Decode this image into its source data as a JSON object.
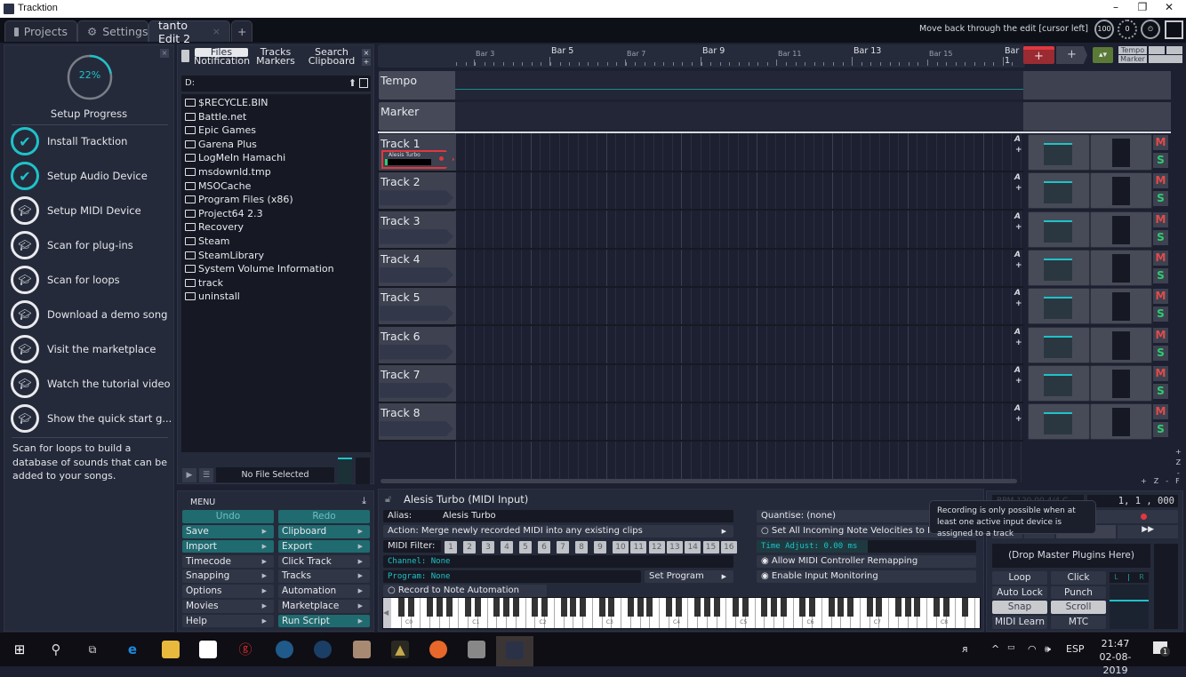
{
  "window": {
    "title": "Tracktion",
    "minimize": "–",
    "maximize": "❐",
    "close": "✕"
  },
  "tabs": [
    {
      "label": "Projects",
      "icon": "folder-icon"
    },
    {
      "label": "Settings",
      "icon": "gear-icon"
    },
    {
      "label": "tanto Edit 2",
      "active": true,
      "close": "×"
    }
  ],
  "add_tab": "+",
  "header": {
    "hint": "Move back through the edit [cursor left]",
    "knob1": "100",
    "knob2": "0"
  },
  "setup": {
    "progress_percent": 22,
    "progress_label": "22%",
    "title": "Setup Progress",
    "close": "×",
    "steps": [
      {
        "label": "Install Tracktion",
        "done": true
      },
      {
        "label": "Setup Audio Device",
        "done": true
      },
      {
        "label": "Setup MIDI Device",
        "done": false
      },
      {
        "label": "Scan for plug-ins",
        "done": false
      },
      {
        "label": "Scan for loops",
        "done": false
      },
      {
        "label": "Download a demo song",
        "done": false
      },
      {
        "label": "Visit the marketplace",
        "done": false
      },
      {
        "label": "Watch the tutorial video",
        "done": false
      },
      {
        "label": "Show the quick start g...",
        "done": false
      }
    ],
    "description": "Scan for loops to build a database of sounds that can be added to your songs."
  },
  "browser": {
    "tabs": [
      {
        "top": "Files",
        "bottom": "Notification"
      },
      {
        "top": "Tracks",
        "bottom": "Markers"
      },
      {
        "top": "Search",
        "bottom": "Clipboard"
      }
    ],
    "close": "×",
    "add": "+",
    "path": "D:",
    "files": [
      "$RECYCLE.BIN",
      "Battle.net",
      "Epic Games",
      "Garena Plus",
      "LogMeIn Hamachi",
      "msdownld.tmp",
      "MSOCache",
      "Program Files (x86)",
      "Project64 2.3",
      "Recovery",
      "Steam",
      "SteamLibrary",
      "System Volume Information",
      "track",
      "uninstall"
    ],
    "no_file": "No File Selected"
  },
  "menu": {
    "title": "MENU",
    "undo": "Undo",
    "redo": "Redo",
    "left": [
      "Save",
      "Import",
      "Timecode",
      "Snapping",
      "Options",
      "Movies",
      "Help"
    ],
    "right": [
      "Clipboard",
      "Export",
      "Click Track",
      "Tracks",
      "Automation",
      "Marketplace",
      "Run Script"
    ]
  },
  "ruler": {
    "bars": [
      {
        "label": "Bar 3",
        "major": false
      },
      {
        "label": "Bar 5",
        "major": true
      },
      {
        "label": "Bar 7",
        "major": false
      },
      {
        "label": "Bar 9",
        "major": true
      },
      {
        "label": "Bar 11",
        "major": false
      },
      {
        "label": "Bar 13",
        "major": true
      },
      {
        "label": "Bar 15",
        "major": false
      },
      {
        "label": "Bar 1",
        "major": true
      }
    ],
    "add_red": "+",
    "add_grey": "+",
    "tempo_btn": "Tempo",
    "marker_btn": "Marker"
  },
  "lanes": {
    "tempo": "Tempo",
    "marker": "Marker"
  },
  "tracks": [
    {
      "name": "Track 1",
      "clip": "Alesis Turbo"
    },
    {
      "name": "Track 2"
    },
    {
      "name": "Track 3"
    },
    {
      "name": "Track 4"
    },
    {
      "name": "Track 5"
    },
    {
      "name": "Track 6"
    },
    {
      "name": "Track 7"
    },
    {
      "name": "Track 8"
    }
  ],
  "track_buttons": {
    "auto": "A",
    "add": "+",
    "mute": "M",
    "solo": "S"
  },
  "zoom_controls": {
    "plus": "+",
    "z": "Z",
    "minus": "-",
    "f": "F"
  },
  "properties": {
    "title": "Alesis Turbo (MIDI Input)",
    "alias_label": "Alias:",
    "alias_value": "Alesis Turbo",
    "action": "Action: Merge newly recorded MIDI into any existing clips",
    "midi_filter_label": "MIDI Filter:",
    "midi_channels": [
      "1",
      "2",
      "3",
      "4",
      "5",
      "6",
      "7",
      "8",
      "9",
      "10",
      "11",
      "12",
      "13",
      "14",
      "15",
      "16"
    ],
    "channel": "Channel: None",
    "program": "Program: None",
    "set_program": "Set Program",
    "record_note_automation": "Record to Note Automation",
    "quantise": "Quantise: (none)",
    "velocities": "Set All Incoming Note Velocities to Full",
    "time_adjust": "Time Adjust: 0.00 ms",
    "allow_remap": "Allow MIDI Controller Remapping",
    "input_monitoring": "Enable Input Monitoring"
  },
  "keyboard": {
    "octave_labels": [
      "C0",
      "C1",
      "C2",
      "C3",
      "C4",
      "C5",
      "C6",
      "C7",
      "C8"
    ]
  },
  "transport": {
    "bpm": "BPM 120.00",
    "sig": "4/4",
    "key": "C",
    "position": "1, 1 , 000",
    "drop_plugins": "(Drop Master Plugins Here)",
    "buttons": [
      {
        "label": "Loop",
        "on": false
      },
      {
        "label": "Click",
        "on": false
      },
      {
        "label": "Auto Lock",
        "on": false
      },
      {
        "label": "Punch",
        "on": false
      },
      {
        "label": "Snap",
        "on": true
      },
      {
        "label": "Scroll",
        "on": true
      },
      {
        "label": "MIDI Learn",
        "on": false
      },
      {
        "label": "MTC",
        "on": false
      }
    ],
    "meter_l": "L",
    "meter_r": "R"
  },
  "tooltip": "Recording is only possible when at least one active input device is assigned to a track",
  "taskbar": {
    "time": "21:47",
    "date": "02-08-2019",
    "lang": "ESP",
    "notifications": "1"
  },
  "colors": {
    "accent": "#1ec2c9",
    "record": "#e0383e",
    "mute": "#e24b4b",
    "solo": "#2ecc71",
    "panel": "#252a3a"
  }
}
